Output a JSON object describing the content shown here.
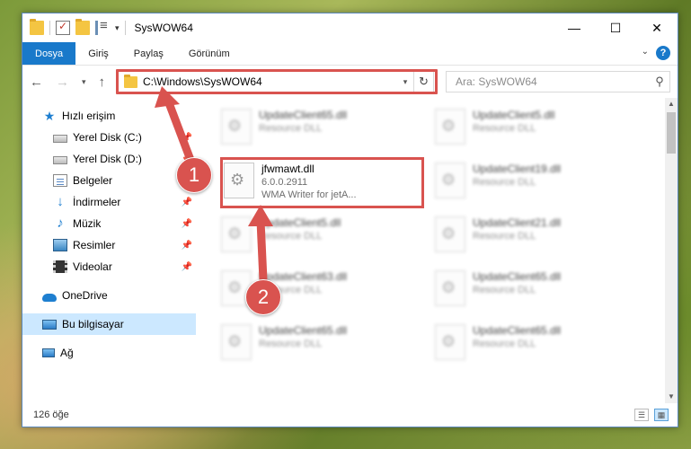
{
  "window": {
    "title": "SysWOW64",
    "minimize": "—",
    "maximize": "☐",
    "close": "✕"
  },
  "ribbon": {
    "tabs": [
      "Dosya",
      "Giriş",
      "Paylaş",
      "Görünüm"
    ],
    "active_tab": "Dosya",
    "help": "?"
  },
  "address": {
    "path": "C:\\Windows\\SysWOW64",
    "search_placeholder": "Ara: SysWOW64"
  },
  "sidebar": {
    "items": [
      {
        "label": "Hızlı erişim",
        "icon": "star-icon",
        "pinned": false
      },
      {
        "label": "Yerel Disk (C:)",
        "icon": "drive-icon",
        "pinned": true
      },
      {
        "label": "Yerel Disk (D:)",
        "icon": "drive-icon",
        "pinned": true
      },
      {
        "label": "Belgeler",
        "icon": "documents-icon",
        "pinned": true
      },
      {
        "label": "İndirmeler",
        "icon": "downloads-icon",
        "pinned": true
      },
      {
        "label": "Müzik",
        "icon": "music-icon",
        "pinned": true
      },
      {
        "label": "Resimler",
        "icon": "pictures-icon",
        "pinned": true
      },
      {
        "label": "Videolar",
        "icon": "videos-icon",
        "pinned": true
      },
      {
        "label": "OneDrive",
        "icon": "onedrive-icon",
        "pinned": false
      },
      {
        "label": "Bu bilgisayar",
        "icon": "computer-icon",
        "pinned": false,
        "selected": true
      },
      {
        "label": "Ağ",
        "icon": "network-icon",
        "pinned": false
      }
    ]
  },
  "files": {
    "left": [
      {
        "name": "UpdateClient65.dll",
        "sub": "Resource DLL"
      },
      {
        "name": "jfwmawt.dll",
        "sub": "6.0.0.2911",
        "sub2": "WMA Writer for jetA...",
        "highlighted": true
      },
      {
        "name": "UpdateClient5.dll",
        "sub": "Resource DLL"
      },
      {
        "name": "UpdateClient63.dll",
        "sub": "Resource DLL"
      },
      {
        "name": "UpdateClient65.dll",
        "sub": "Resource DLL"
      }
    ],
    "right": [
      {
        "name": "UpdateClient5.dll",
        "sub": "Resource DLL"
      },
      {
        "name": "UpdateClient19.dll",
        "sub": "Resource DLL"
      },
      {
        "name": "UpdateClient21.dll",
        "sub": "Resource DLL"
      },
      {
        "name": "UpdateClient65.dll",
        "sub": "Resource DLL"
      },
      {
        "name": "UpdateClient65.dll",
        "sub": "Resource DLL"
      }
    ]
  },
  "status": {
    "count": "126 öğe"
  },
  "callouts": [
    "1",
    "2"
  ],
  "colors": {
    "accent": "#1979ca",
    "highlight": "#d9534f",
    "selected": "#cce8ff"
  }
}
